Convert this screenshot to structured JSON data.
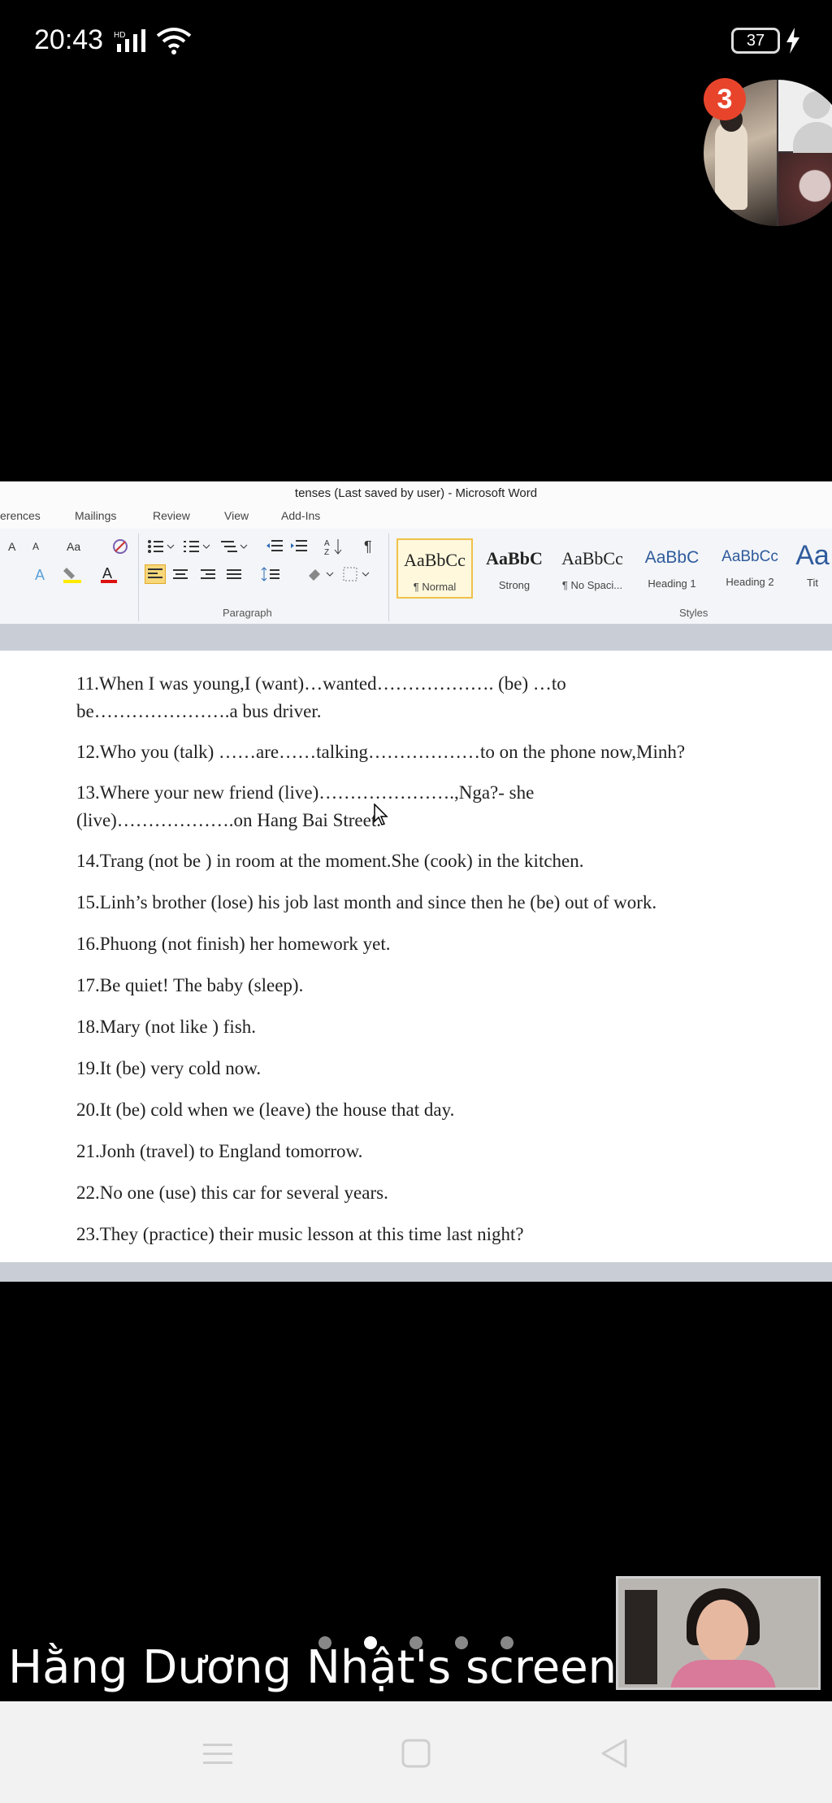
{
  "status_bar": {
    "time": "20:43",
    "battery": "37",
    "icons": [
      "signal-icon",
      "wifi-icon",
      "battery-icon",
      "charging-icon"
    ]
  },
  "participants": {
    "badge_count": "3"
  },
  "word": {
    "window_title": "tenses (Last saved by user) - Microsoft Word",
    "tabs": [
      "erences",
      "Mailings",
      "Review",
      "View",
      "Add-Ins"
    ],
    "groups": {
      "paragraph": "Paragraph",
      "styles": "Styles"
    },
    "font_buttons": {
      "grow": "A",
      "shrink": "A",
      "case": "Aa"
    },
    "show_marks": "¶",
    "styles": [
      {
        "sample": "AaBbCc",
        "name": "¶ Normal"
      },
      {
        "sample": "AaBbC",
        "name": "Strong"
      },
      {
        "sample": "AaBbCc",
        "name": "¶ No Spaci..."
      },
      {
        "sample": "AaBbC",
        "name": "Heading 1"
      },
      {
        "sample": "AaBbCc",
        "name": "Heading 2"
      },
      {
        "sample": "Aa",
        "name": "Tit"
      }
    ],
    "document_lines": [
      "11.When I was young,I (want)…wanted………………. (be) …to",
      "be………………….a bus  driver.",
      "12.Who you (talk) ……are……talking………………to on the phone now,Minh?",
      "13.Where  your new friend (live)………………….,Nga?- she",
      "(live)……………….on Hang Bai Street.",
      "14.Trang (not be ) in  room at the moment.She (cook) in the kitchen.",
      "15.Linh’s brother (lose) his job last month and since then he (be) out of work.",
      "16.Phuong (not finish) her homework yet.",
      "17.Be quiet! The baby (sleep).",
      "18.Mary (not like ) fish.",
      "19.It (be) very cold now.",
      "20.It (be) cold when we (leave) the house that day.",
      "21.Jonh (travel) to England tomorrow.",
      "22.No one (use) this car for several years.",
      "23.They (practice) their music lesson at this time last night?"
    ]
  },
  "screen_share": {
    "label": "Hằng Dương Nhật's screen",
    "pages": 5,
    "active_page": 2
  },
  "nav_bar": {
    "icons": [
      "menu-icon",
      "home-square-icon",
      "back-triangle-icon"
    ]
  }
}
